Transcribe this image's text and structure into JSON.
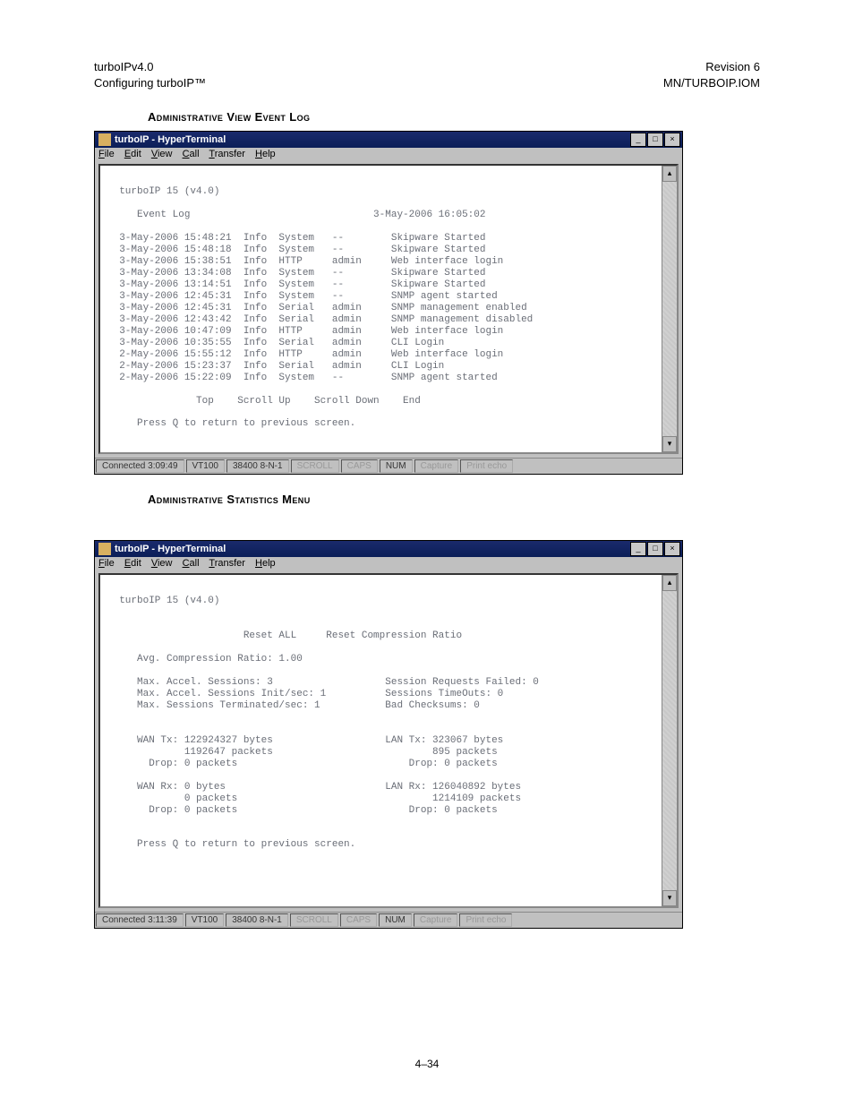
{
  "page_header": {
    "left1": "turboIPv4.0",
    "left2": "Configuring turboIP™",
    "right1": "Revision 6",
    "right2": "MN/TURBOIP.IOM"
  },
  "caption1": "Administrative View Event Log",
  "caption2": "Administrative Statistics Menu",
  "window": {
    "title": "turboIP - HyperTerminal",
    "menus": {
      "file": "File",
      "edit": "Edit",
      "view": "View",
      "call": "Call",
      "transfer": "Transfer",
      "help": "Help"
    },
    "winbtns": {
      "min": "_",
      "max": "□",
      "close": "×"
    }
  },
  "status1": {
    "conn": "Connected 3:09:49",
    "emul": "VT100",
    "cfg": "38400 8-N-1",
    "scroll": "SCROLL",
    "caps": "CAPS",
    "num": "NUM",
    "capture": "Capture",
    "echo": "Print echo"
  },
  "status2": {
    "conn": "Connected 3:11:39",
    "emul": "VT100",
    "cfg": "38400 8-N-1",
    "scroll": "SCROLL",
    "caps": "CAPS",
    "num": "NUM",
    "capture": "Capture",
    "echo": "Print echo"
  },
  "event_log": {
    "banner": "turboIP 15 (v4.0)",
    "title": "Event Log",
    "timestamp": "3-May-2006 16:05:02",
    "nav": {
      "top": "Top",
      "up": "Scroll Up",
      "down": "Scroll Down",
      "end": "End"
    },
    "hint": "Press Q to return to previous screen.",
    "rows": [
      {
        "dt": "3-May-2006 15:48:21",
        "lvl": "Info",
        "src": "System",
        "user": "--",
        "msg": "Skipware Started"
      },
      {
        "dt": "3-May-2006 15:48:18",
        "lvl": "Info",
        "src": "System",
        "user": "--",
        "msg": "Skipware Started"
      },
      {
        "dt": "3-May-2006 15:38:51",
        "lvl": "Info",
        "src": "HTTP",
        "user": "admin",
        "msg": "Web interface login"
      },
      {
        "dt": "3-May-2006 13:34:08",
        "lvl": "Info",
        "src": "System",
        "user": "--",
        "msg": "Skipware Started"
      },
      {
        "dt": "3-May-2006 13:14:51",
        "lvl": "Info",
        "src": "System",
        "user": "--",
        "msg": "Skipware Started"
      },
      {
        "dt": "3-May-2006 12:45:31",
        "lvl": "Info",
        "src": "System",
        "user": "--",
        "msg": "SNMP agent started"
      },
      {
        "dt": "3-May-2006 12:45:31",
        "lvl": "Info",
        "src": "Serial",
        "user": "admin",
        "msg": "SNMP management enabled"
      },
      {
        "dt": "3-May-2006 12:43:42",
        "lvl": "Info",
        "src": "Serial",
        "user": "admin",
        "msg": "SNMP management disabled"
      },
      {
        "dt": "3-May-2006 10:47:09",
        "lvl": "Info",
        "src": "HTTP",
        "user": "admin",
        "msg": "Web interface login"
      },
      {
        "dt": "3-May-2006 10:35:55",
        "lvl": "Info",
        "src": "Serial",
        "user": "admin",
        "msg": "CLI Login"
      },
      {
        "dt": "2-May-2006 15:55:12",
        "lvl": "Info",
        "src": "HTTP",
        "user": "admin",
        "msg": "Web interface login"
      },
      {
        "dt": "2-May-2006 15:23:37",
        "lvl": "Info",
        "src": "Serial",
        "user": "admin",
        "msg": "CLI Login"
      },
      {
        "dt": "2-May-2006 15:22:09",
        "lvl": "Info",
        "src": "System",
        "user": "--",
        "msg": "SNMP agent started"
      }
    ]
  },
  "stats": {
    "banner": "turboIP 15 (v4.0)",
    "reset_all": "Reset ALL",
    "reset_comp": "Reset Compression Ratio",
    "avg_comp": "Avg. Compression Ratio: 1.00",
    "left_block": [
      "Max. Accel. Sessions: 3",
      "Max. Accel. Sessions Init/sec: 1",
      "Max. Sessions Terminated/sec: 1"
    ],
    "right_block": [
      "Session Requests Failed: 0",
      "Sessions TimeOuts: 0",
      "Bad Checksums: 0"
    ],
    "wan_tx": {
      "l": "WAN Tx: 122924327 bytes",
      "p": "1192647 packets",
      "d": "Drop: 0 packets"
    },
    "lan_tx": {
      "l": "LAN Tx: 323067 bytes",
      "p": "895 packets",
      "d": "Drop: 0 packets"
    },
    "wan_rx": {
      "l": "WAN Rx: 0 bytes",
      "p": "0 packets",
      "d": "Drop: 0 packets"
    },
    "lan_rx": {
      "l": "LAN Rx: 126040892 bytes",
      "p": "1214109 packets",
      "d": "Drop: 0 packets"
    },
    "hint": "Press Q to return to previous screen."
  },
  "page_number": "4–34"
}
